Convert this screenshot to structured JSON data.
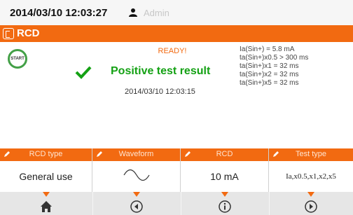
{
  "header": {
    "datetime": "2014/03/10 12:03:27",
    "user": "Admin"
  },
  "title": {
    "text": "RCD"
  },
  "status": {
    "start_label": "START",
    "ready": "READY!",
    "result": "Positive test result",
    "result_time": "2014/03/10 12:03:15"
  },
  "readings": [
    "Ia(Sin+) = 5.8 mA",
    "ta(Sin+)x0.5 > 300 ms",
    "ta(Sin+)x1 = 32 ms",
    "ta(Sin+)x2 = 32 ms",
    "ta(Sin+)x5 = 32 ms"
  ],
  "params": {
    "rcd_type": {
      "label": "RCD type",
      "value": "General use"
    },
    "waveform": {
      "label": "Waveform",
      "icon": "sine-wave-icon"
    },
    "rcd": {
      "label": "RCD",
      "value": "10 mA"
    },
    "test_type": {
      "label": "Test type",
      "value": "Ia,x0.5,x1,x2,x5"
    }
  },
  "nav": [
    "home-icon",
    "back-icon",
    "info-icon",
    "next-icon"
  ],
  "colors": {
    "accent": "#f26a11",
    "success": "#14a114",
    "start_ring": "#43a047"
  }
}
